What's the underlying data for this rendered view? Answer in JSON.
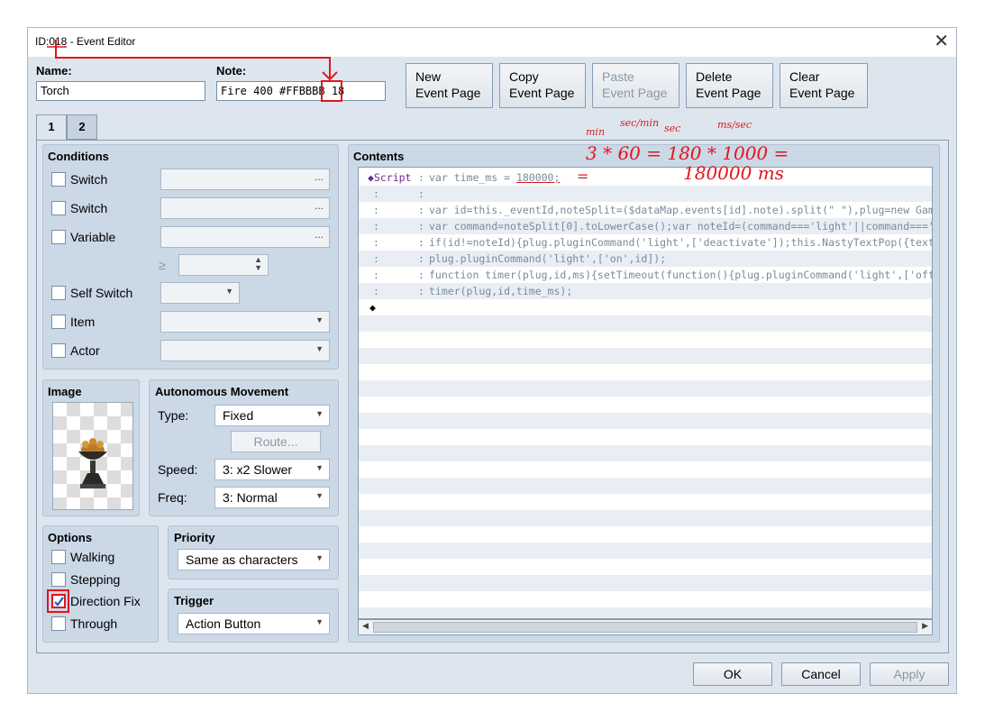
{
  "window": {
    "title": "ID:018 - Event Editor"
  },
  "header": {
    "name_label": "Name:",
    "name_value": "Torch",
    "note_label": "Note:",
    "note_value": "Fire 400 #FFBBBB 18"
  },
  "toolbar": {
    "new_1": "New",
    "new_2": "Event Page",
    "copy_1": "Copy",
    "copy_2": "Event Page",
    "paste_1": "Paste",
    "paste_2": "Event Page",
    "delete_1": "Delete",
    "delete_2": "Event Page",
    "clear_1": "Clear",
    "clear_2": "Event Page"
  },
  "tabs": [
    "1",
    "2"
  ],
  "conditions": {
    "title": "Conditions",
    "switch1": "Switch",
    "switch2": "Switch",
    "variable": "Variable",
    "gte": "≥",
    "self_switch": "Self Switch",
    "item": "Item",
    "actor": "Actor",
    "dots": "..."
  },
  "image": {
    "title": "Image"
  },
  "movement": {
    "title": "Autonomous Movement",
    "type_label": "Type:",
    "type_value": "Fixed",
    "route": "Route...",
    "speed_label": "Speed:",
    "speed_value": "3: x2 Slower",
    "freq_label": "Freq:",
    "freq_value": "3: Normal"
  },
  "options": {
    "title": "Options",
    "walking": "Walking",
    "stepping": "Stepping",
    "direction_fix": "Direction Fix",
    "through": "Through",
    "direction_fix_checked": true
  },
  "priority": {
    "title": "Priority",
    "value": "Same as characters"
  },
  "trigger": {
    "title": "Trigger",
    "value": "Action Button"
  },
  "contents": {
    "title": "Contents",
    "script_label": "◆Script",
    "sep": ":",
    "line0_a": "var time_ms  =  ",
    "line0_b": "180000;",
    "lines": [
      "",
      "var id=this._eventId,noteSplit=($dataMap.events[id].note).split(\" \"),plug=new Game",
      "var command=noteSplit[0].toLowerCase();var noteId=(command==='light'||command==='f",
      "if(id!=noteId){plug.pluginCommand('light',['deactivate']);this.NastyTextPop({text:",
      "plug.pluginCommand('light',['on',id]);",
      "function timer(plug,id,ms){setTimeout(function(){plug.pluginCommand('light',['off'",
      "timer(plug,id,time_ms);"
    ],
    "end_marker": "◆"
  },
  "footer": {
    "ok": "OK",
    "cancel": "Cancel",
    "apply": "Apply"
  },
  "annotations": {
    "min": "min",
    "sec_min": "sec/min",
    "sec": "sec",
    "ms_sec": "ms/sec",
    "equation": "3 * 60 = 180 * 1000 =",
    "result": "180000 ms",
    "dash": "="
  }
}
